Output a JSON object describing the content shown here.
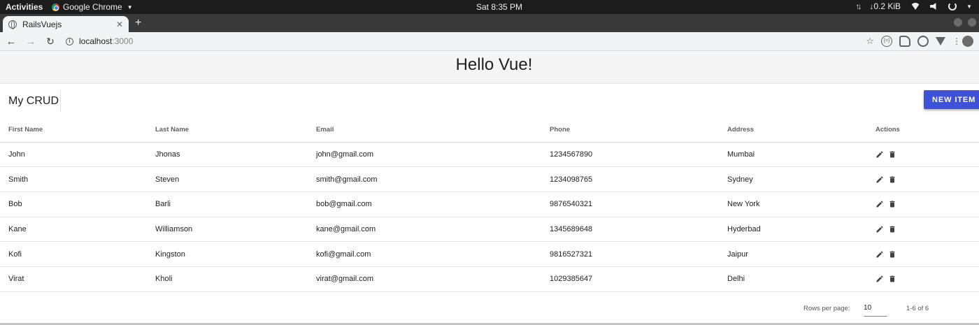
{
  "system": {
    "activities": "Activities",
    "app_name": "Google Chrome",
    "clock": "Sat  8:35 PM",
    "net_speed": "↓0.2 KiB"
  },
  "browser": {
    "tab_title": "RailsVuejs",
    "url_host": "localhost",
    "url_port": ":3000"
  },
  "app": {
    "title": "Hello Vue!",
    "crud_title": "My CRUD",
    "new_item_label": "NEW ITEM",
    "accent_color": "#3f51d7"
  },
  "table": {
    "headers": [
      "First Name",
      "Last Name",
      "Email",
      "Phone",
      "Address",
      "Actions"
    ],
    "rows": [
      {
        "first": "John",
        "last": "Jhonas",
        "email": "john@gmail.com",
        "phone": "1234567890",
        "address": "Mumbai"
      },
      {
        "first": "Smith",
        "last": "Steven",
        "email": "smith@gmail.com",
        "phone": "1234098765",
        "address": "Sydney"
      },
      {
        "first": "Bob",
        "last": "Barli",
        "email": "bob@gmail.com",
        "phone": "9876540321",
        "address": "New York"
      },
      {
        "first": "Kane",
        "last": "Williamson",
        "email": "kane@gmail.com",
        "phone": "1345689648",
        "address": "Hyderbad"
      },
      {
        "first": "Kofi",
        "last": "Kingston",
        "email": "kofi@gmail.com",
        "phone": "9816527321",
        "address": "Jaipur"
      },
      {
        "first": "Virat",
        "last": "Kholi",
        "email": "virat@gmail.com",
        "phone": "1029385647",
        "address": "Delhi"
      }
    ],
    "row_actions": [
      "edit-icon",
      "delete-icon"
    ]
  },
  "pagination": {
    "rows_per_page_label": "Rows per page:",
    "rows_per_page_value": "10",
    "page_info": "1-6 of 6"
  }
}
